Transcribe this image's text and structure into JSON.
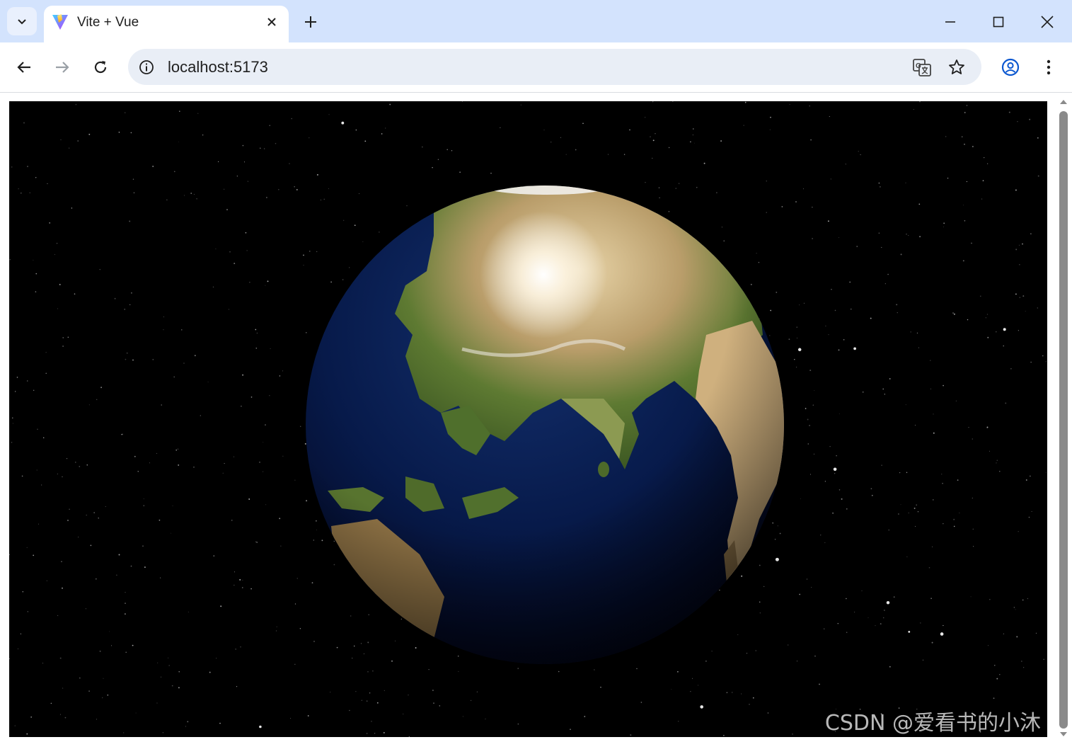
{
  "tab": {
    "title": "Vite + Vue",
    "favicon": "vite-logo-icon",
    "close": "close-icon"
  },
  "toolbar": {
    "url": "localhost:5173",
    "back": "arrow-left-icon",
    "forward": "arrow-right-icon",
    "reload": "reload-icon",
    "site_info": "info-icon",
    "translate": "translate-icon",
    "bookmark": "star-icon",
    "profile": "account-icon",
    "menu": "kebab-menu-icon"
  },
  "window_controls": [
    "minimize-icon",
    "maximize-icon",
    "close-icon"
  ],
  "content": {
    "scene": "three.js earth globe with starfield background",
    "watermark": "CSDN @爱看书的小沐"
  },
  "colors": {
    "tabstrip": "#d3e3fd",
    "omnibox": "#e9eef6",
    "accent": "#0b57d0",
    "scene_bg": "#000000"
  }
}
